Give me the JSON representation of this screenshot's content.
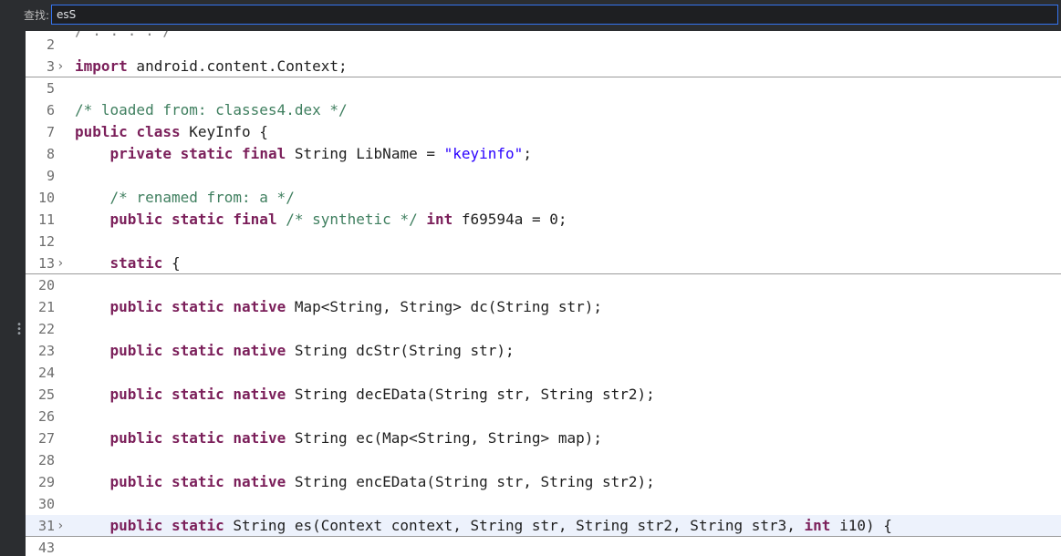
{
  "find_bar": {
    "label": "查找:",
    "value": "esS"
  },
  "editor": {
    "lines": [
      {
        "n": "2",
        "fold": "",
        "tokens": []
      },
      {
        "n": "3",
        "fold": "›",
        "sep": true,
        "tokens": [
          {
            "t": "import",
            "c": "kw"
          },
          {
            "t": " android.content.Context;"
          }
        ]
      },
      {
        "n": "5",
        "fold": "",
        "tokens": []
      },
      {
        "n": "6",
        "fold": "",
        "tokens": [
          {
            "t": "/* loaded from: classes4.dex */",
            "c": "cm"
          }
        ]
      },
      {
        "n": "7",
        "fold": "",
        "tokens": [
          {
            "t": "public",
            "c": "kw"
          },
          {
            "t": " "
          },
          {
            "t": "class",
            "c": "kw"
          },
          {
            "t": " KeyInfo {"
          }
        ]
      },
      {
        "n": "8",
        "fold": "",
        "tokens": [
          {
            "t": "    "
          },
          {
            "t": "private",
            "c": "kw"
          },
          {
            "t": " "
          },
          {
            "t": "static",
            "c": "kw"
          },
          {
            "t": " "
          },
          {
            "t": "final",
            "c": "kw"
          },
          {
            "t": " String LibName = "
          },
          {
            "t": "\"keyinfo\"",
            "c": "st"
          },
          {
            "t": ";"
          }
        ]
      },
      {
        "n": "9",
        "fold": "",
        "tokens": []
      },
      {
        "n": "10",
        "fold": "",
        "tokens": [
          {
            "t": "    "
          },
          {
            "t": "/* renamed from: a */",
            "c": "cm"
          }
        ]
      },
      {
        "n": "11",
        "fold": "",
        "tokens": [
          {
            "t": "    "
          },
          {
            "t": "public",
            "c": "kw"
          },
          {
            "t": " "
          },
          {
            "t": "static",
            "c": "kw"
          },
          {
            "t": " "
          },
          {
            "t": "final",
            "c": "kw"
          },
          {
            "t": " "
          },
          {
            "t": "/* synthetic */",
            "c": "cm"
          },
          {
            "t": " "
          },
          {
            "t": "int",
            "c": "kw"
          },
          {
            "t": " f69594a = 0;"
          }
        ]
      },
      {
        "n": "12",
        "fold": "",
        "tokens": []
      },
      {
        "n": "13",
        "fold": "›",
        "sep": true,
        "tokens": [
          {
            "t": "    "
          },
          {
            "t": "static",
            "c": "kw"
          },
          {
            "t": " {"
          }
        ]
      },
      {
        "n": "20",
        "fold": "",
        "tokens": []
      },
      {
        "n": "21",
        "fold": "",
        "tokens": [
          {
            "t": "    "
          },
          {
            "t": "public",
            "c": "kw"
          },
          {
            "t": " "
          },
          {
            "t": "static",
            "c": "kw"
          },
          {
            "t": " "
          },
          {
            "t": "native",
            "c": "kw"
          },
          {
            "t": " Map<String, String> dc(String str);"
          }
        ]
      },
      {
        "n": "22",
        "fold": "",
        "tokens": []
      },
      {
        "n": "23",
        "fold": "",
        "tokens": [
          {
            "t": "    "
          },
          {
            "t": "public",
            "c": "kw"
          },
          {
            "t": " "
          },
          {
            "t": "static",
            "c": "kw"
          },
          {
            "t": " "
          },
          {
            "t": "native",
            "c": "kw"
          },
          {
            "t": " String dcStr(String str);"
          }
        ]
      },
      {
        "n": "24",
        "fold": "",
        "tokens": []
      },
      {
        "n": "25",
        "fold": "",
        "tokens": [
          {
            "t": "    "
          },
          {
            "t": "public",
            "c": "kw"
          },
          {
            "t": " "
          },
          {
            "t": "static",
            "c": "kw"
          },
          {
            "t": " "
          },
          {
            "t": "native",
            "c": "kw"
          },
          {
            "t": " String decEData(String str, String str2);"
          }
        ]
      },
      {
        "n": "26",
        "fold": "",
        "tokens": []
      },
      {
        "n": "27",
        "fold": "",
        "tokens": [
          {
            "t": "    "
          },
          {
            "t": "public",
            "c": "kw"
          },
          {
            "t": " "
          },
          {
            "t": "static",
            "c": "kw"
          },
          {
            "t": " "
          },
          {
            "t": "native",
            "c": "kw"
          },
          {
            "t": " String ec(Map<String, String> map);"
          }
        ]
      },
      {
        "n": "28",
        "fold": "",
        "tokens": []
      },
      {
        "n": "29",
        "fold": "",
        "tokens": [
          {
            "t": "    "
          },
          {
            "t": "public",
            "c": "kw"
          },
          {
            "t": " "
          },
          {
            "t": "static",
            "c": "kw"
          },
          {
            "t": " "
          },
          {
            "t": "native",
            "c": "kw"
          },
          {
            "t": " String encEData(String str, String str2);"
          }
        ]
      },
      {
        "n": "30",
        "fold": "",
        "tokens": []
      },
      {
        "n": "31",
        "fold": "›",
        "sep": true,
        "highlight": true,
        "tokens": [
          {
            "t": "    "
          },
          {
            "t": "public",
            "c": "kw"
          },
          {
            "t": " "
          },
          {
            "t": "static",
            "c": "kw"
          },
          {
            "t": " String es(Context context, String str, String str2, String str3, "
          },
          {
            "t": "int",
            "c": "kw"
          },
          {
            "t": " i10) {"
          }
        ]
      },
      {
        "n": "43",
        "fold": "",
        "tokens": []
      }
    ]
  }
}
